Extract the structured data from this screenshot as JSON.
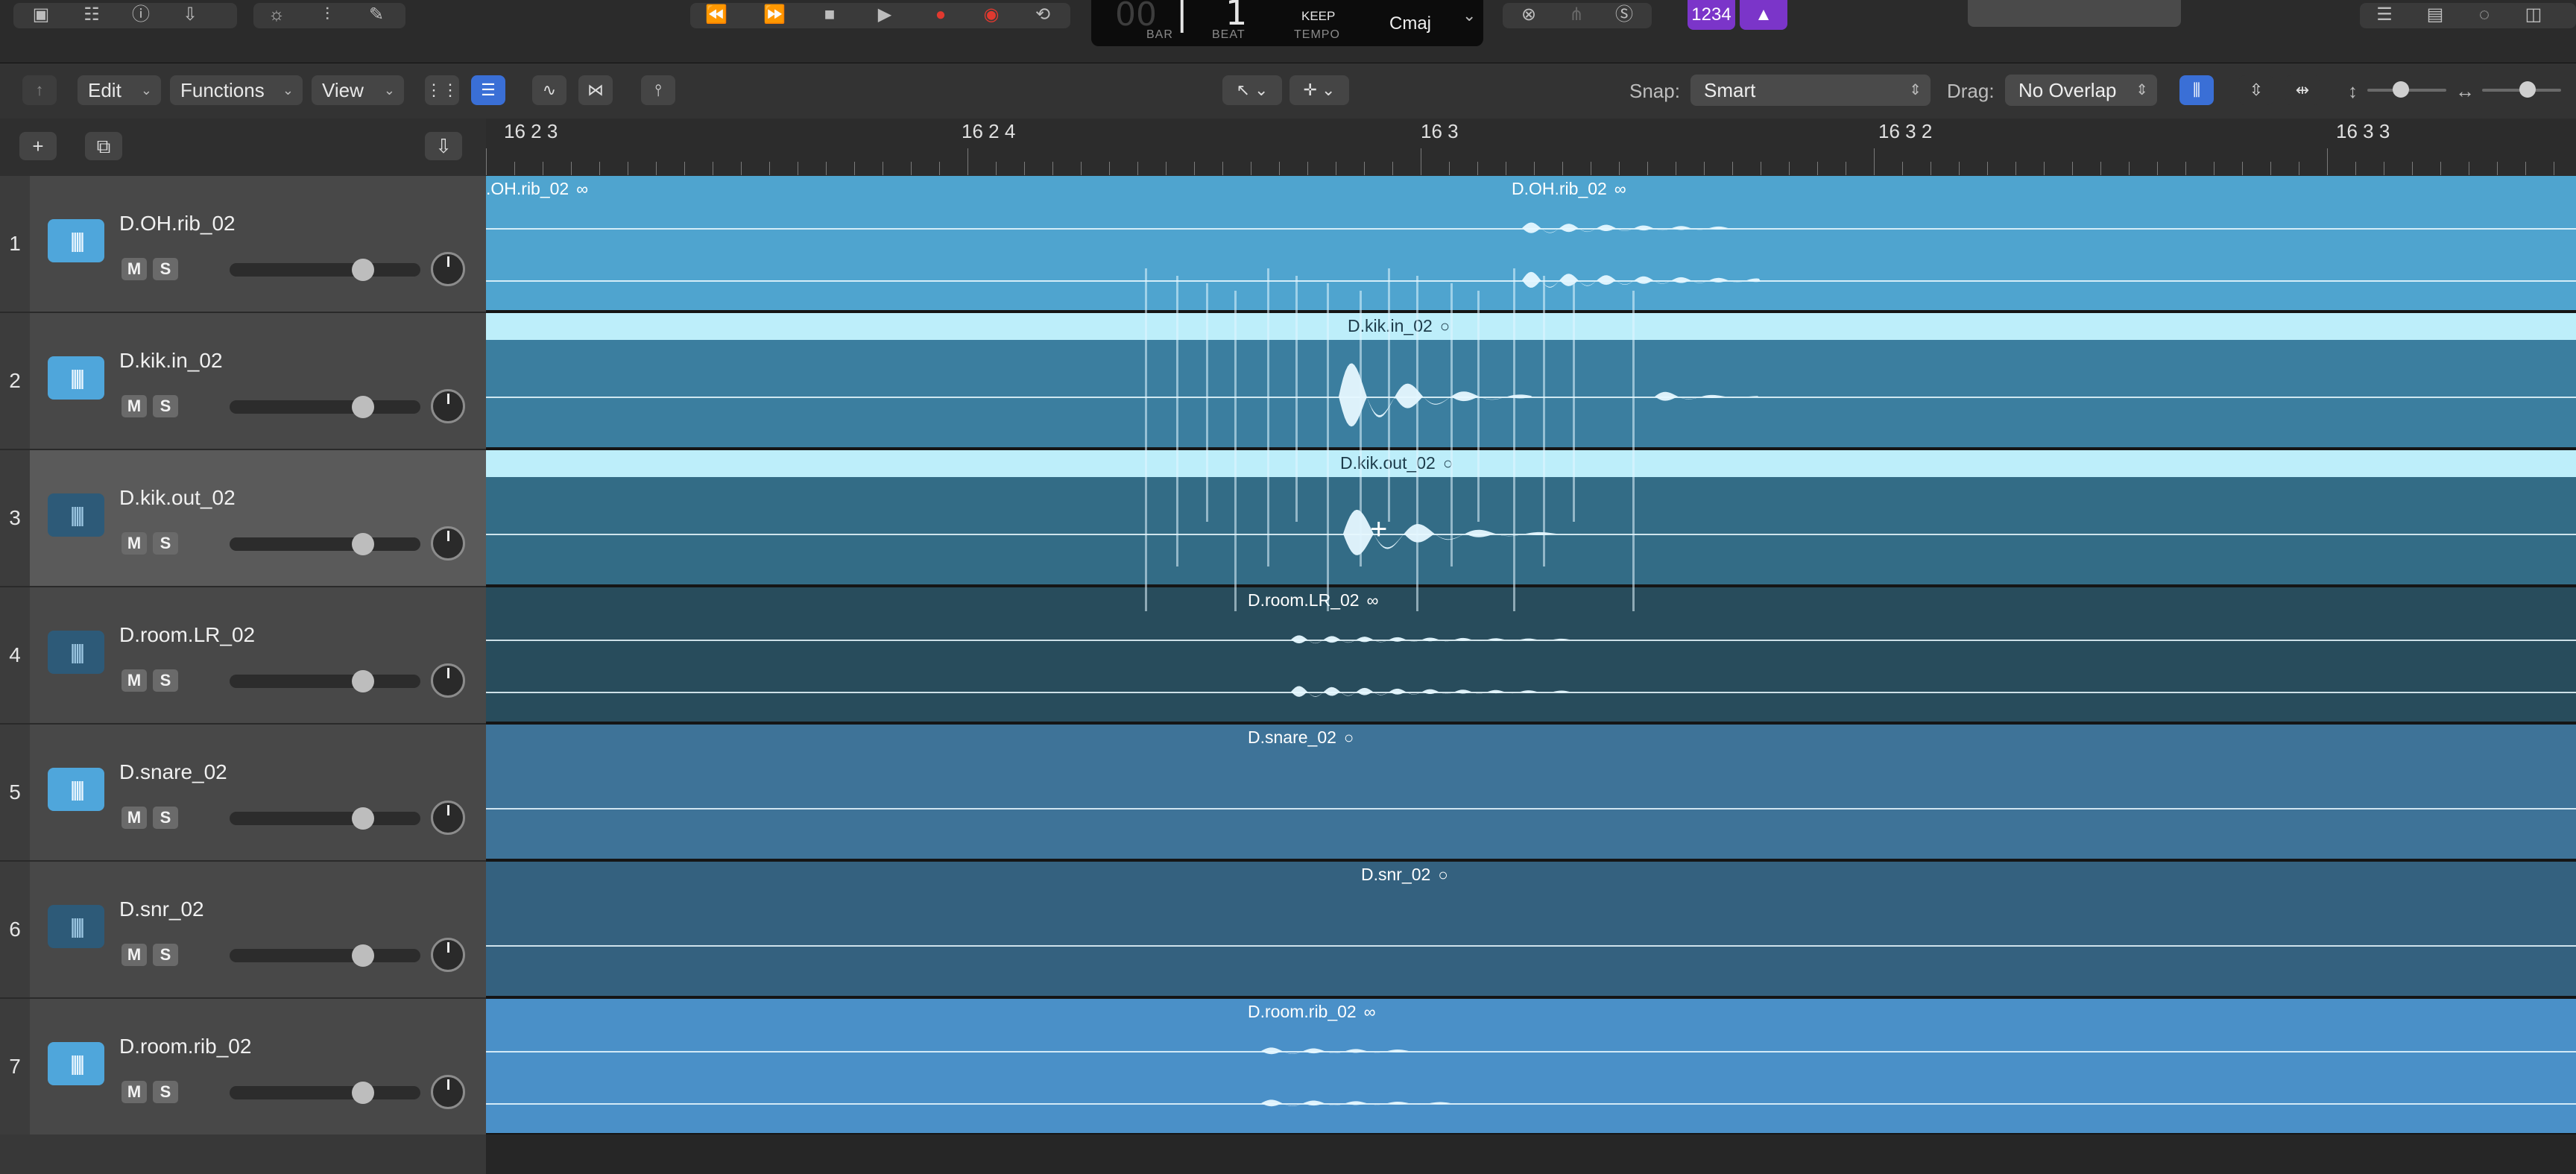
{
  "lcd": {
    "bar_label": "BAR",
    "beat_label": "BEAT",
    "tempo_label": "TEMPO",
    "keep_text": "KEEP",
    "key": "Cmaj",
    "bar_digits": "00",
    "beat_value": "1"
  },
  "counter_badge": "1234",
  "toolbar": {
    "edit": "Edit",
    "functions": "Functions",
    "view": "View",
    "snap_label": "Snap:",
    "snap_value": "Smart",
    "drag_label": "Drag:",
    "drag_value": "No Overlap"
  },
  "ruler": {
    "markers": [
      "16 2 3",
      "16 2 4",
      "16 3",
      "16 3 2",
      "16 3 3"
    ]
  },
  "tracks": [
    {
      "number": "1",
      "name": "D.OH.rib_02",
      "mute": "M",
      "solo": "S",
      "region": "D.OH.rib_02",
      "region_left": ".OH.rib_02"
    },
    {
      "number": "2",
      "name": "D.kik.in_02",
      "mute": "M",
      "solo": "S",
      "region": "D.kik.in_02"
    },
    {
      "number": "3",
      "name": "D.kik.out_02",
      "mute": "M",
      "solo": "S",
      "region": "D.kik.out_02"
    },
    {
      "number": "4",
      "name": "D.room.LR_02",
      "mute": "M",
      "solo": "S",
      "region": "D.room.LR_02"
    },
    {
      "number": "5",
      "name": "D.snare_02",
      "mute": "M",
      "solo": "S",
      "region": "D.snare_02"
    },
    {
      "number": "6",
      "name": "D.snr_02",
      "mute": "M",
      "solo": "S",
      "region": "D.snr_02"
    },
    {
      "number": "7",
      "name": "D.room.rib_02",
      "mute": "M",
      "solo": "S",
      "region": "D.room.rib_02"
    }
  ],
  "colors": {
    "lane_1": "#4fa4cf",
    "lane_2": "#3b7e9f",
    "lane_3": "#336c86",
    "lane_4": "#284c5c",
    "lane_5": "#3e7398",
    "lane_6": "#34617f",
    "lane_7": "#4a90c8",
    "region_header": "#bdeefa",
    "record": "#e0392f",
    "badge": "#7b35c9",
    "accent": "#3a6fd6"
  }
}
